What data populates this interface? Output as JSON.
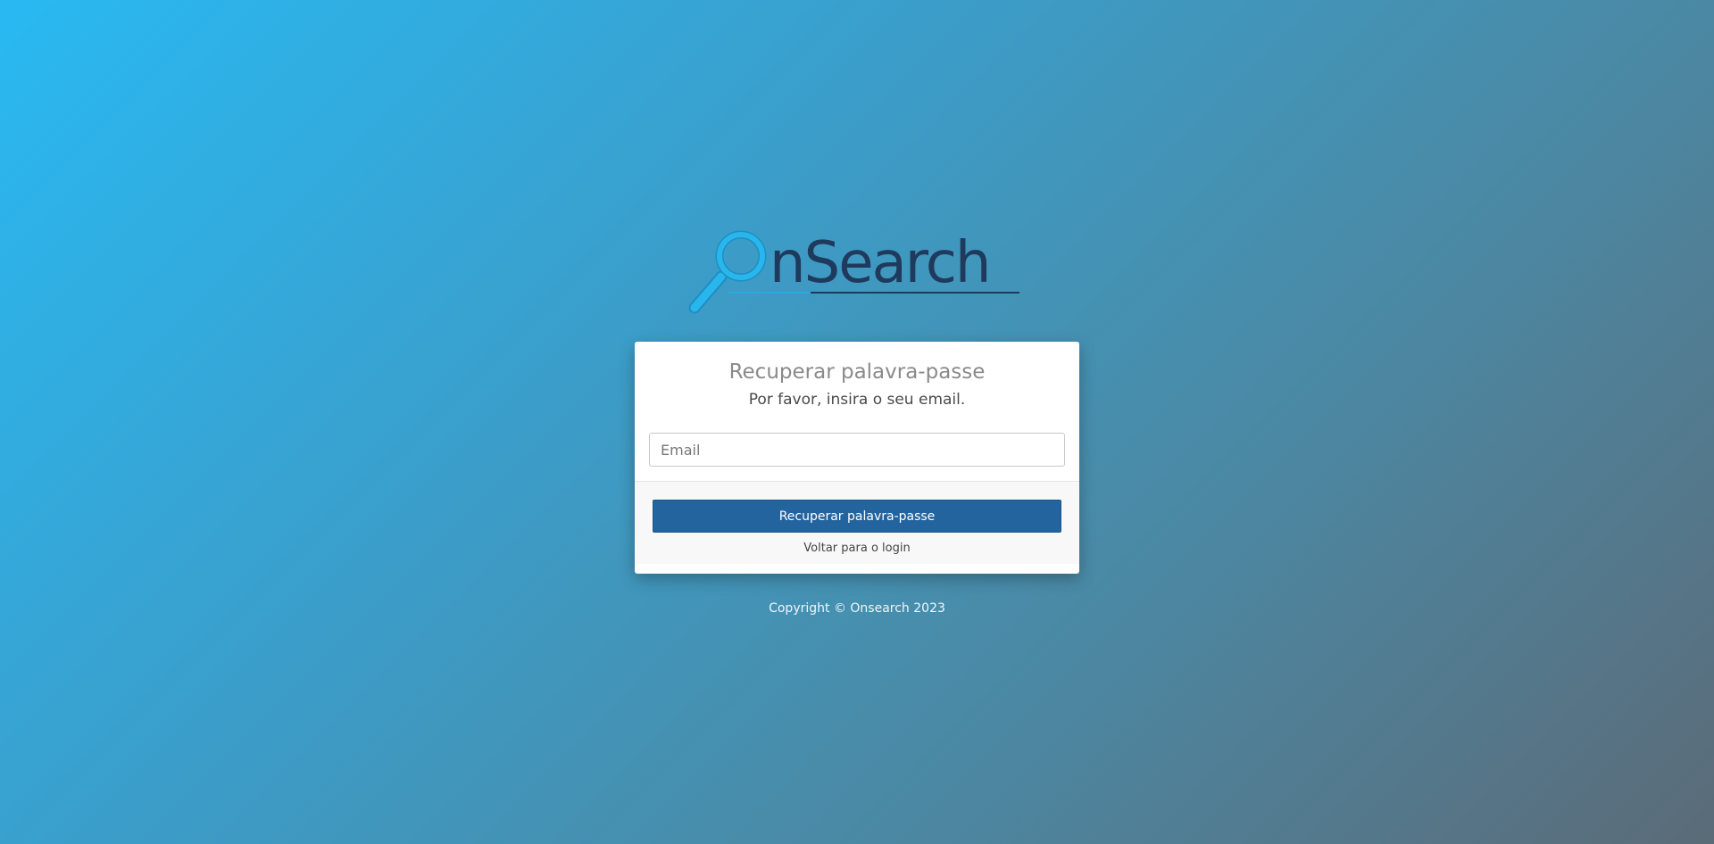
{
  "brand": {
    "logo_text": "OnSearch",
    "colors": {
      "magnifier": "#29b6ec",
      "wordmark": "#1f3a5c"
    }
  },
  "recover_form": {
    "title": "Recuperar palavra-passe",
    "subtitle": "Por favor, insira o seu email.",
    "email_placeholder": "Email",
    "email_value": "",
    "submit_label": "Recuperar palavra-passe",
    "back_link_label": "Voltar para o login"
  },
  "footer": {
    "copyright": "Copyright © Onsearch 2023"
  },
  "colors": {
    "primary_button": "#23649e",
    "background_start": "#29b9f2",
    "background_end": "#5b6b78"
  }
}
